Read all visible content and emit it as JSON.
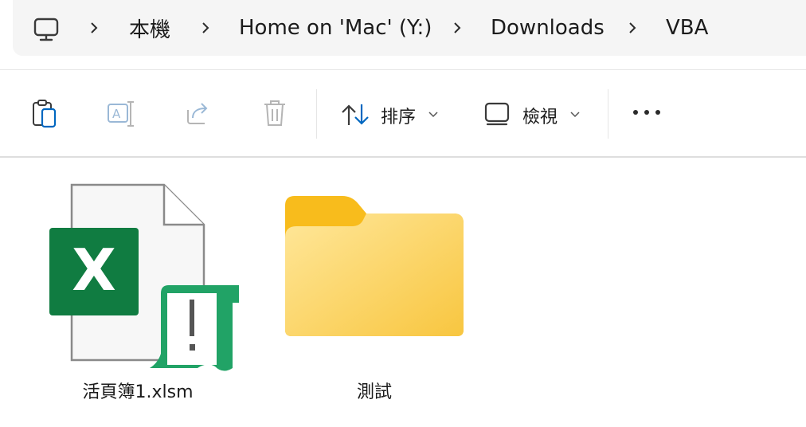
{
  "address_bar": {
    "breadcrumbs": [
      {
        "label": "本機"
      },
      {
        "label": "Home on 'Mac' (Y:)"
      },
      {
        "label": "Downloads"
      },
      {
        "label": "VBA"
      }
    ],
    "root_icon": "computer-icon"
  },
  "toolbar": {
    "paste_icon": "clipboard-icon",
    "rename_icon": "rename-icon",
    "share_icon": "share-icon",
    "delete_icon": "trash-icon",
    "sort_label": "排序",
    "view_label": "檢視",
    "more_icon": "more-icon"
  },
  "files": [
    {
      "name": "活頁簿1.xlsm",
      "type": "excel-macro-file",
      "icon": "excel-macro-icon"
    },
    {
      "name": "測試",
      "type": "folder",
      "icon": "folder-icon"
    }
  ],
  "colors": {
    "excel_green": "#107c41",
    "macro_green": "#21a366",
    "folder_back": "#f8c12e",
    "folder_front": "#ffe08a",
    "accent_blue": "#0067c0"
  }
}
